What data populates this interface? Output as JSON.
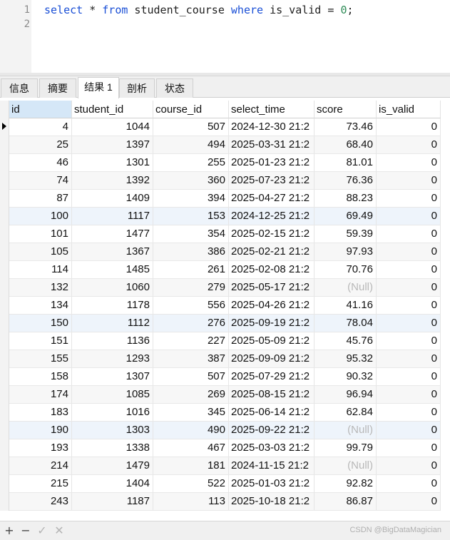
{
  "editor": {
    "line_numbers": [
      "1",
      "2"
    ],
    "sql": {
      "kw_select": "select",
      "star": " * ",
      "kw_from": "from",
      "table": " student_course ",
      "kw_where": "where",
      "cond": " is_valid = ",
      "value": "0",
      "end": ";"
    }
  },
  "tabs": [
    "信息",
    "摘要",
    "结果 1",
    "剖析",
    "状态"
  ],
  "active_tab": "结果 1",
  "columns": [
    "id",
    "student_id",
    "course_id",
    "select_time",
    "score",
    "is_valid"
  ],
  "rows": [
    [
      "4",
      "1044",
      "507",
      "2024-12-30 21:2",
      "73.46",
      "0"
    ],
    [
      "25",
      "1397",
      "494",
      "2025-03-31 21:2",
      "68.40",
      "0"
    ],
    [
      "46",
      "1301",
      "255",
      "2025-01-23 21:2",
      "81.01",
      "0"
    ],
    [
      "74",
      "1392",
      "360",
      "2025-07-23 21:2",
      "76.36",
      "0"
    ],
    [
      "87",
      "1409",
      "394",
      "2025-04-27 21:2",
      "88.23",
      "0"
    ],
    [
      "100",
      "1117",
      "153",
      "2024-12-25 21:2",
      "69.49",
      "0"
    ],
    [
      "101",
      "1477",
      "354",
      "2025-02-15 21:2",
      "59.39",
      "0"
    ],
    [
      "105",
      "1367",
      "386",
      "2025-02-21 21:2",
      "97.93",
      "0"
    ],
    [
      "114",
      "1485",
      "261",
      "2025-02-08 21:2",
      "70.76",
      "0"
    ],
    [
      "132",
      "1060",
      "279",
      "2025-05-17 21:2",
      "(Null)",
      "0"
    ],
    [
      "134",
      "1178",
      "556",
      "2025-04-26 21:2",
      "41.16",
      "0"
    ],
    [
      "150",
      "1112",
      "276",
      "2025-09-19 21:2",
      "78.04",
      "0"
    ],
    [
      "151",
      "1136",
      "227",
      "2025-05-09 21:2",
      "45.76",
      "0"
    ],
    [
      "155",
      "1293",
      "387",
      "2025-09-09 21:2",
      "95.32",
      "0"
    ],
    [
      "158",
      "1307",
      "507",
      "2025-07-29 21:2",
      "90.32",
      "0"
    ],
    [
      "174",
      "1085",
      "269",
      "2025-08-15 21:2",
      "96.94",
      "0"
    ],
    [
      "183",
      "1016",
      "345",
      "2025-06-14 21:2",
      "62.84",
      "0"
    ],
    [
      "190",
      "1303",
      "490",
      "2025-09-22 21:2",
      "(Null)",
      "0"
    ],
    [
      "193",
      "1338",
      "467",
      "2025-03-03 21:2",
      "99.79",
      "0"
    ],
    [
      "214",
      "1479",
      "181",
      "2024-11-15 21:2",
      "(Null)",
      "0"
    ],
    [
      "215",
      "1404",
      "522",
      "2025-01-03 21:2",
      "92.82",
      "0"
    ],
    [
      "243",
      "1187",
      "113",
      "2025-10-18 21:2",
      "86.87",
      "0"
    ]
  ],
  "footer": {
    "add": "+",
    "remove": "−",
    "apply": "✓",
    "discard": "✕",
    "watermark": "CSDN @BigDataMagician"
  }
}
